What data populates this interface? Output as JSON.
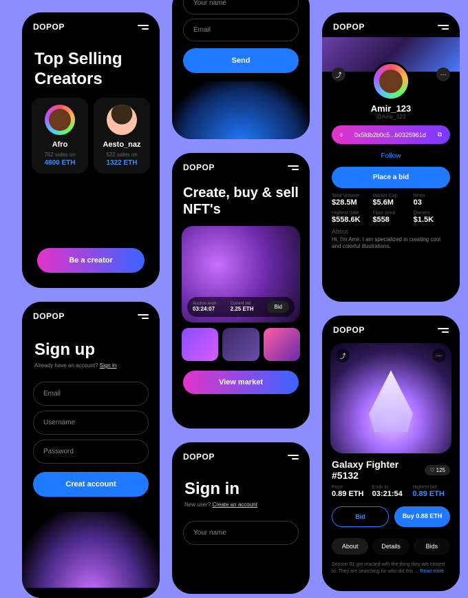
{
  "brand": "DOPOP",
  "s1": {
    "title": "Top Selling Creators",
    "creators": [
      {
        "name": "Afro",
        "sub": "762 sales on",
        "eth": "4800 ETH"
      },
      {
        "name": "Aesto_naz",
        "sub": "522 sales on",
        "eth": "1322 ETH"
      }
    ],
    "cta": "Be a creator"
  },
  "s2": {
    "fields": [
      "Your name",
      "Email"
    ],
    "send": "Send"
  },
  "s3": {
    "name": "Amir_123",
    "handle": "@Amir_123",
    "address": "0x5fdb2b0c5...b0325961d",
    "follow": "Follow",
    "bid": "Place a bid",
    "stats1": [
      {
        "label": "Total Volume",
        "value": "$28.5M"
      },
      {
        "label": "Market Cap",
        "value": "$5.6M"
      },
      {
        "label": "Items",
        "value": "03"
      }
    ],
    "stats2": [
      {
        "label": "Highest Sale",
        "value": "$558.6K"
      },
      {
        "label": "Floor price",
        "value": "$558"
      },
      {
        "label": "Owners",
        "value": "$1.5K"
      }
    ],
    "about_label": "About",
    "about": "Hi, I'm Amir. I am specialized in creating cool and colorful illustrations."
  },
  "s4": {
    "title": "Create, buy & sell NFT's",
    "auction_label": "Auction ends",
    "auction": "03:24:07",
    "bid_label": "Current bid",
    "bid_value": "2.25 ETH",
    "bid_btn": "Bid",
    "view": "View market"
  },
  "s5": {
    "title": "Sign up",
    "sub_pre": "Already have an account? ",
    "sub_link": "Sign in",
    "fields": [
      "Email",
      "Username",
      "Password"
    ],
    "create": "Creat account"
  },
  "s6": {
    "name": "Galaxy Fighter #5132",
    "likes": "125",
    "price_label": "Price",
    "price": "0.89 ETH",
    "ends_label": "Ends in",
    "ends": "03:21:54",
    "high_label": "Highest bid",
    "high": "0.89 ETH",
    "bid": "Bid",
    "buy": "Buy 0.88 ETH",
    "tabs": [
      "About",
      "Details",
      "Bids"
    ],
    "desc": "Season 01 got reacted with the thing they are closest to. They are searching for who did this ... ",
    "readmore": "Read more"
  },
  "s7": {
    "title": "Sign in",
    "sub_pre": "New user? ",
    "sub_link": "Create an account",
    "field": "Your name"
  }
}
